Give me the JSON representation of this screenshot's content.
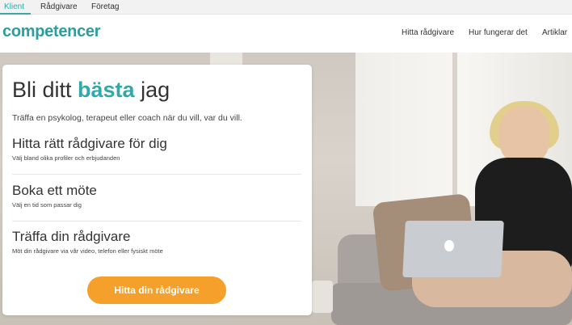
{
  "audience_tabs": [
    {
      "label": "Klient",
      "active": true
    },
    {
      "label": "Rådgivare",
      "active": false
    },
    {
      "label": "Företag",
      "active": false
    }
  ],
  "header": {
    "logo": "competencer",
    "nav": [
      "Hitta rådgivare",
      "Hur fungerar det",
      "Artiklar"
    ]
  },
  "hero": {
    "headline_pre": "Bli ditt ",
    "headline_accent": "bästa",
    "headline_post": " jag",
    "subhead": "Träffa en psykolog, terapeut eller coach när du vill, var du vill.",
    "steps": [
      {
        "title": "Hitta rätt rådgivare för dig",
        "desc": "Välj bland olika profiler och erbjudanden"
      },
      {
        "title": "Boka ett möte",
        "desc": "Välj en tid som passar dig"
      },
      {
        "title": "Träffa din rådgivare",
        "desc": "Möt din rådgivare via vår video, telefon eller fysiskt möte"
      }
    ],
    "cta": "Hitta din rådgivare"
  },
  "colors": {
    "brand_teal": "#2fa9a9",
    "cta_orange": "#f5a02a"
  }
}
